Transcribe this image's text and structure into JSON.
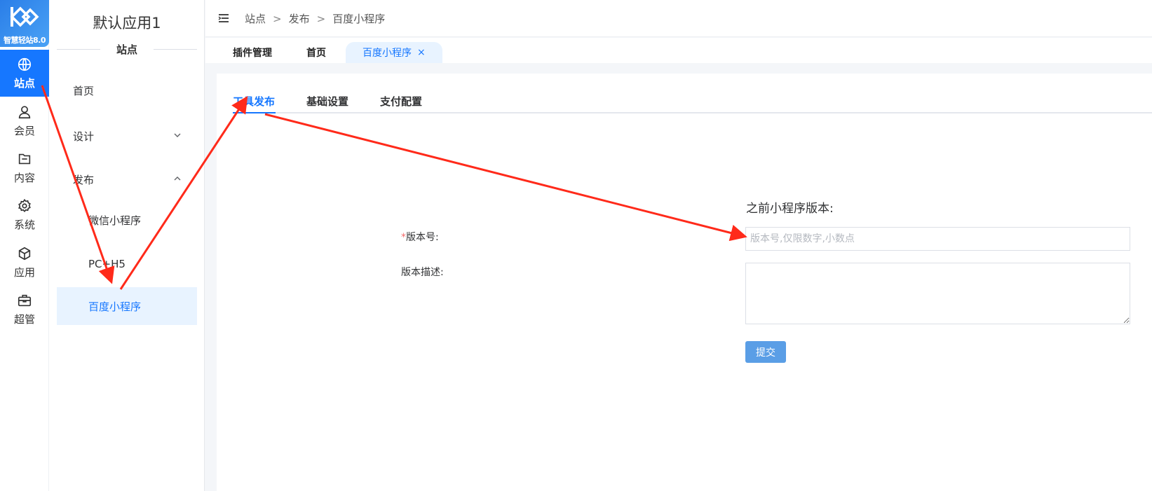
{
  "logo": {
    "text": "智慧轻站8.0"
  },
  "rail": {
    "items": [
      {
        "label": "站点",
        "icon": "globe-icon"
      },
      {
        "label": "会员",
        "icon": "user-icon"
      },
      {
        "label": "内容",
        "icon": "folder-icon"
      },
      {
        "label": "系统",
        "icon": "gear-icon"
      },
      {
        "label": "应用",
        "icon": "cube-icon"
      },
      {
        "label": "超管",
        "icon": "toolbox-icon"
      }
    ]
  },
  "menu": {
    "app_title": "默认应用1",
    "section": "站点",
    "items": [
      {
        "label": "首页"
      },
      {
        "label": "设计"
      },
      {
        "label": "发布"
      },
      {
        "label": "微信小程序"
      },
      {
        "label": "PC+H5"
      },
      {
        "label": "百度小程序"
      }
    ]
  },
  "breadcrumb": {
    "items": [
      "站点",
      "发布",
      "百度小程序"
    ],
    "separator": ">"
  },
  "tabs": {
    "items": [
      "插件管理",
      "首页",
      "百度小程序"
    ],
    "close": "×"
  },
  "inner_tabs": {
    "items": [
      "工具发布",
      "基础设置",
      "支付配置"
    ]
  },
  "form": {
    "prev_version_title": "之前小程序版本:",
    "version_required_mark": "*",
    "version_label": "版本号:",
    "version_placeholder": "版本号,仅限数字,小数点",
    "version_value": "",
    "desc_label": "版本描述:",
    "desc_value": "",
    "submit_label": "提交"
  },
  "colors": {
    "accent": "#1677ff",
    "annotation": "#ff2a1a",
    "active_bg": "#e8f3ff"
  }
}
